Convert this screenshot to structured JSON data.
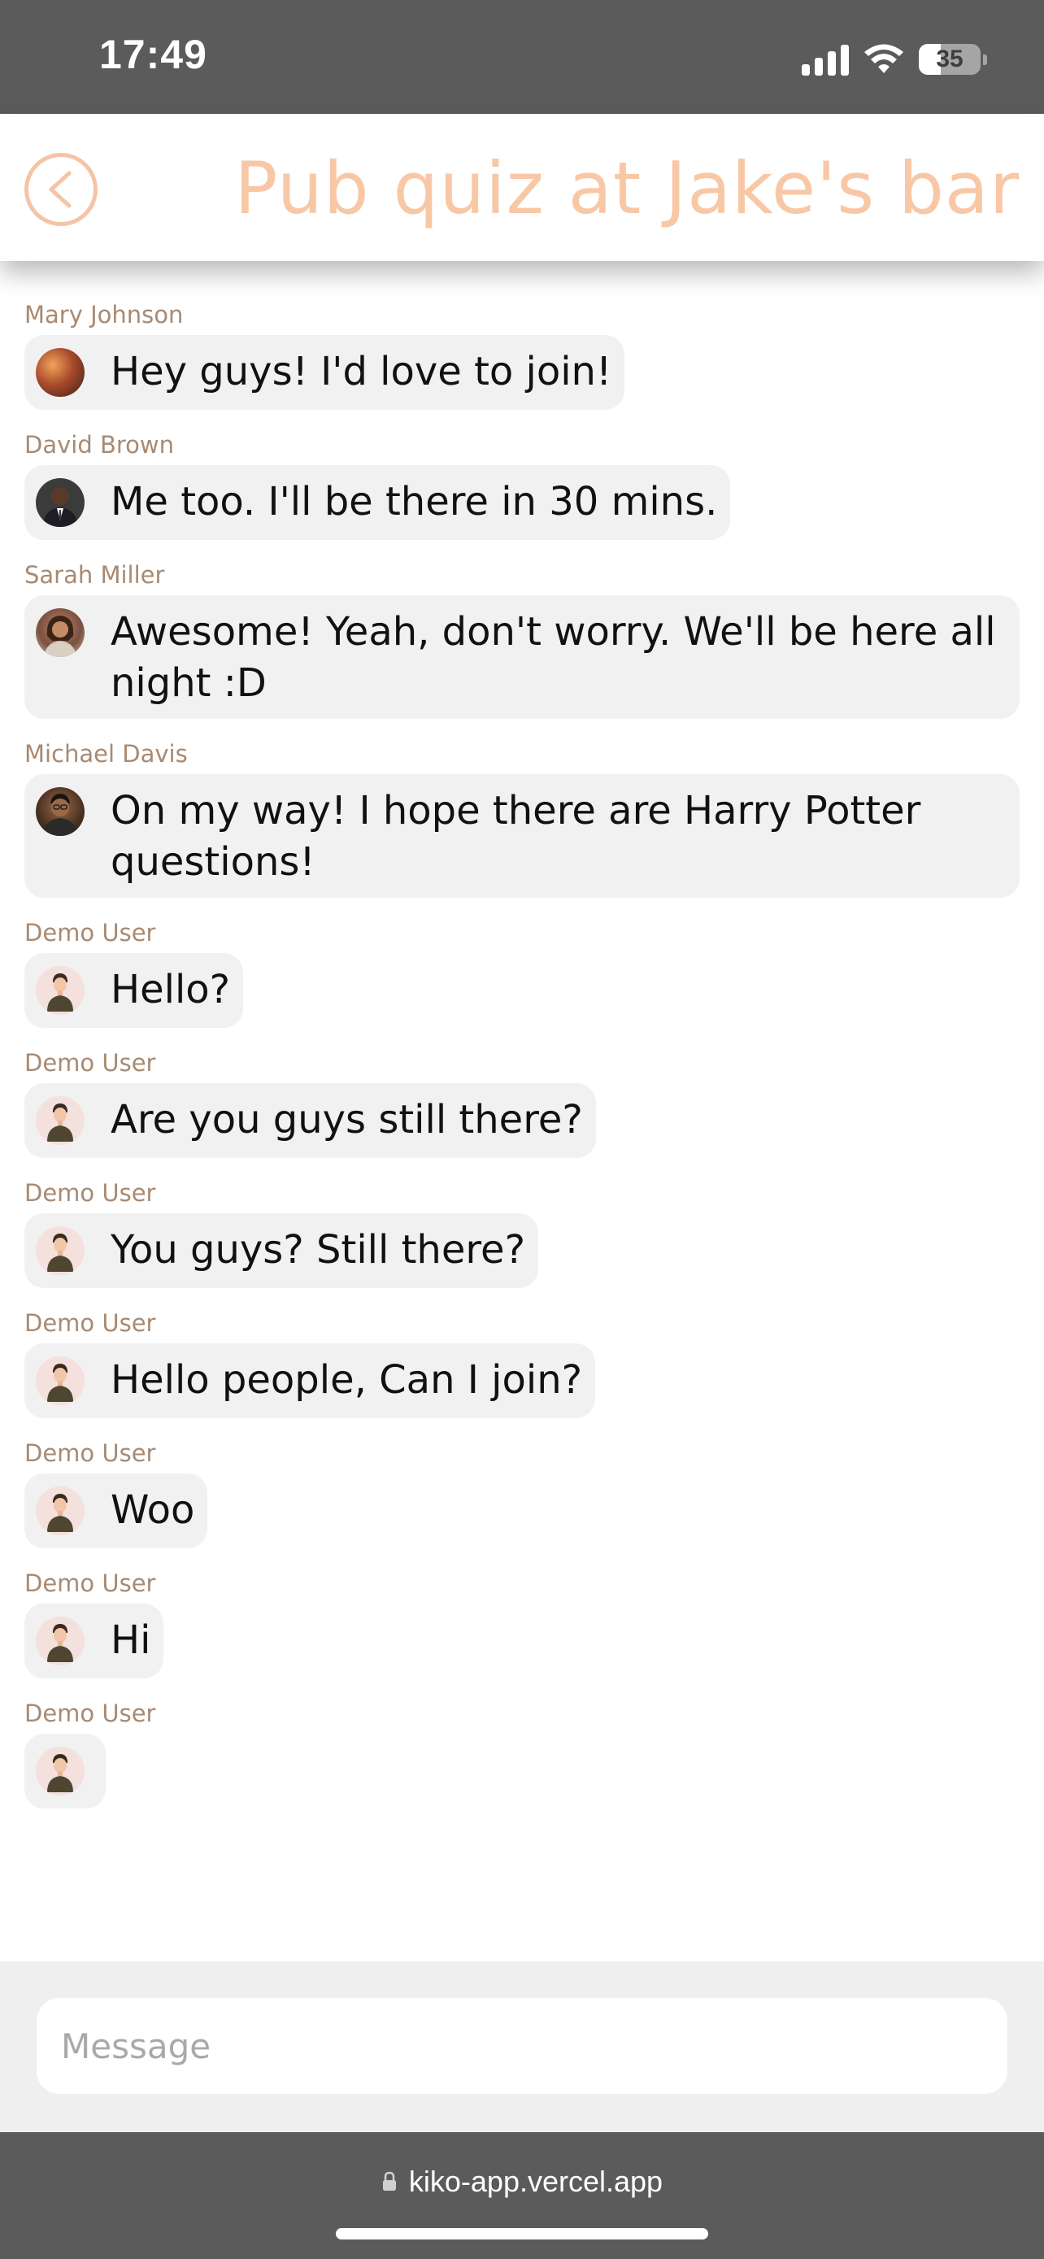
{
  "status_bar": {
    "time": "17:49",
    "battery_level": "35",
    "icons": [
      "signal-icon",
      "wifi-icon",
      "battery-icon"
    ]
  },
  "header": {
    "title": "Pub quiz at Jake's bar",
    "back_icon": "chevron-left-icon",
    "accent_color": "#f8c8a6"
  },
  "messages": [
    {
      "sender": "Mary Johnson",
      "text": "Hey guys! I'd love to join!",
      "avatar": "avatar-mary"
    },
    {
      "sender": "David Brown",
      "text": "Me too. I'll be there in 30 mins.",
      "avatar": "avatar-david"
    },
    {
      "sender": "Sarah Miller",
      "text": "Awesome! Yeah, don't worry. We'll be here all night :D",
      "avatar": "avatar-sarah"
    },
    {
      "sender": "Michael Davis",
      "text": "On my way! I hope there are Harry Potter questions!",
      "avatar": "avatar-michael"
    },
    {
      "sender": "Demo User",
      "text": "Hello?",
      "avatar": "avatar-demo"
    },
    {
      "sender": "Demo User",
      "text": "Are you guys still there?",
      "avatar": "avatar-demo"
    },
    {
      "sender": "Demo User",
      "text": "You guys? Still there?",
      "avatar": "avatar-demo"
    },
    {
      "sender": "Demo User",
      "text": "Hello people, Can I join?",
      "avatar": "avatar-demo"
    },
    {
      "sender": "Demo User",
      "text": "Woo",
      "avatar": "avatar-demo"
    },
    {
      "sender": "Demo User",
      "text": "Hi",
      "avatar": "avatar-demo"
    },
    {
      "sender": "Demo User",
      "text": "",
      "avatar": "avatar-demo"
    }
  ],
  "composer": {
    "placeholder": "Message",
    "value": ""
  },
  "browser": {
    "url": "kiko-app.vercel.app",
    "lock_icon": "lock-icon"
  },
  "colors": {
    "sender_name": "#a88a72",
    "bubble": "#f1f1f1",
    "bars": "#5b5b5b"
  }
}
